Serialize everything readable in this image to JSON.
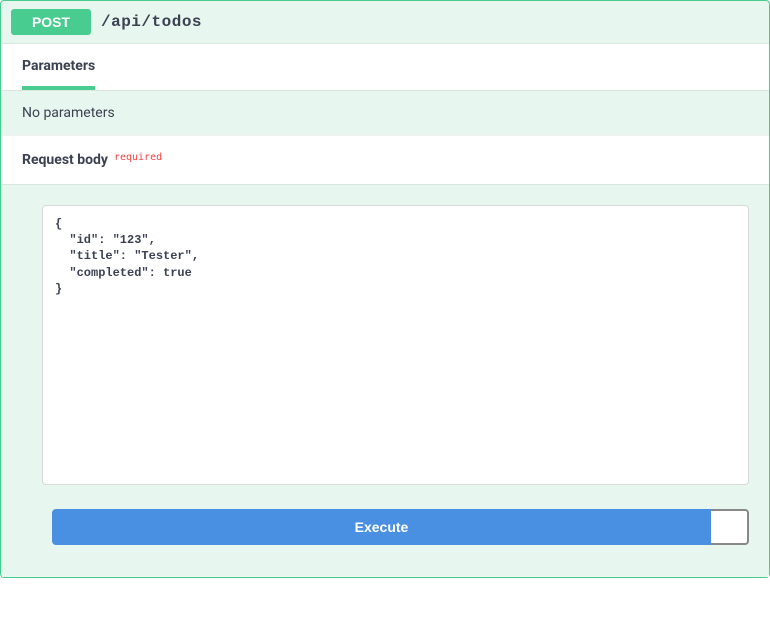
{
  "operation": {
    "method": "POST",
    "path": "/api/todos"
  },
  "tabs": {
    "parameters": "Parameters"
  },
  "parameters": {
    "empty_text": "No parameters"
  },
  "request_body": {
    "label": "Request body",
    "required_text": "required",
    "value": "{\n  \"id\": \"123\",\n  \"title\": \"Tester\",\n  \"completed\": true\n}"
  },
  "actions": {
    "execute": "Execute"
  }
}
